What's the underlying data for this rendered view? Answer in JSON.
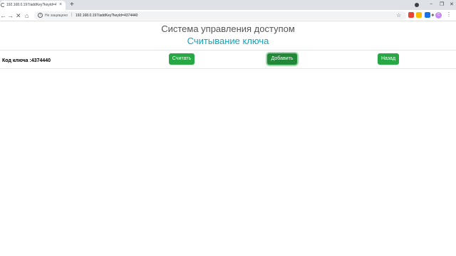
{
  "browser": {
    "tab_title": "192.168.0.197/addKey?keyId=4...",
    "tab_close": "×",
    "new_tab": "+",
    "security_label": "Не защищено",
    "url": "192.168.0.197/addKey?keyId=4374440",
    "profile_initial": "С",
    "icons": [
      "loading-spinner-icon",
      "close-icon",
      "plus-icon",
      "back-icon",
      "forward-icon",
      "stop-icon",
      "home-icon",
      "info-icon",
      "star-icon",
      "extension-icon",
      "puzzle-icon",
      "minimize-icon",
      "restore-icon",
      "close-window-icon",
      "menu-icon"
    ],
    "extension_colors": [
      "#ea4335",
      "#fbbc04",
      "#1a73e8",
      "#5f6368"
    ]
  },
  "page": {
    "system_title": "Система управления доступом",
    "subtitle": "Считывание ключа",
    "key_label": "Код ключа :4374440",
    "buttons": {
      "read": "Считать",
      "add": "Добавить",
      "back": "Назад"
    }
  },
  "colors": {
    "accent": "#17a2b8",
    "button": "#28a745",
    "title": "#555555"
  }
}
